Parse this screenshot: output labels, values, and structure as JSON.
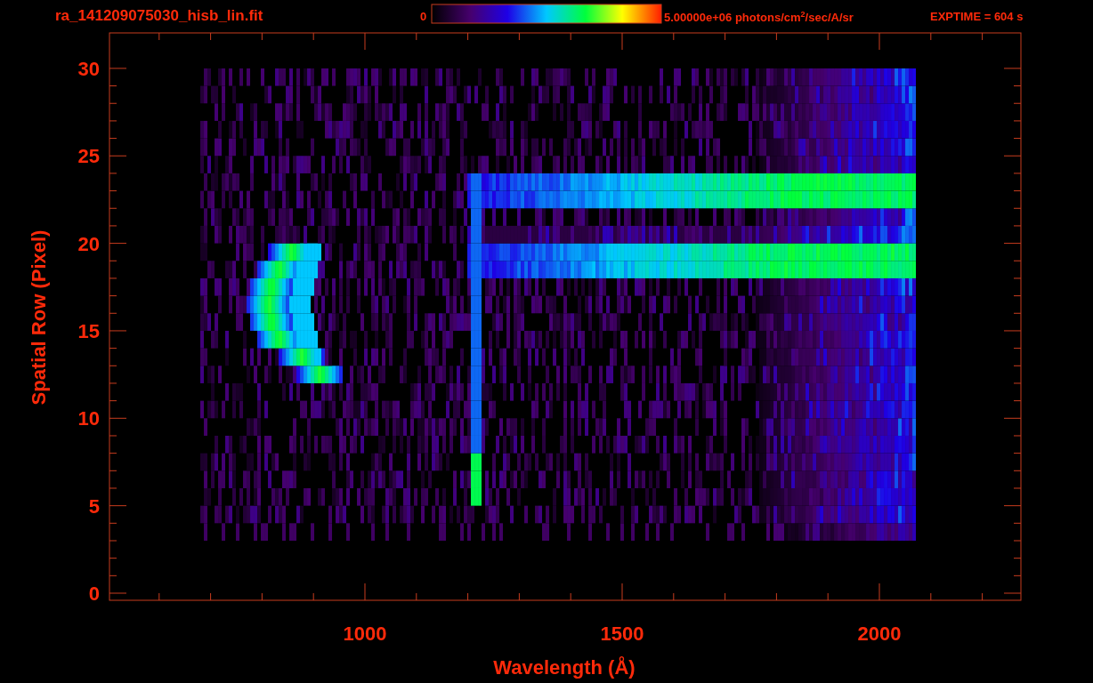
{
  "title": "ra_141209075030_hisb_lin.fit",
  "colorbar": {
    "min_label": "0",
    "max_label": "5.00000e+06 photons/cm$^{2}$/sec/A/sr"
  },
  "exposure": "EXPTIME = 604 s",
  "x_axis": {
    "label": "Wavelength (Å)",
    "ticks": [
      "1000",
      "1500",
      "2000"
    ]
  },
  "y_axis": {
    "label": "Spatial Row (Pixel)",
    "ticks": [
      "30",
      "25",
      "20",
      "15",
      "10",
      "5",
      "0"
    ]
  }
}
